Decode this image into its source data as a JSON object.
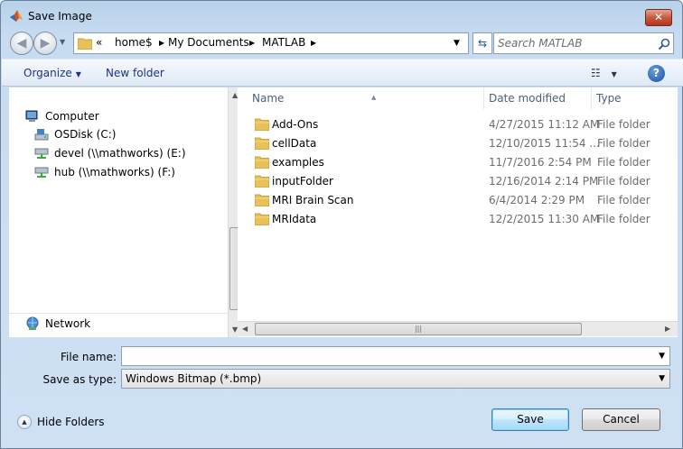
{
  "window": {
    "title": "Save Image",
    "close_glyph": "✕",
    "app_icon": "matlab-logo-icon"
  },
  "navbar": {
    "back_glyph": "◀",
    "forward_glyph": "▶",
    "overflow_glyph": "«",
    "breadcrumbs": [
      {
        "label": "home$"
      },
      {
        "label": "My Documents"
      },
      {
        "label": "MATLAB"
      }
    ],
    "search_placeholder": "Search MATLAB",
    "refresh_glyph": "⇆"
  },
  "toolbar": {
    "organize_label": "Organize",
    "new_folder_label": "New folder",
    "help_label": "?"
  },
  "nav_pane": {
    "items": [
      {
        "label": "Computer",
        "icon": "computer-icon"
      },
      {
        "label": "OSDisk (C:)",
        "icon": "drive-icon"
      },
      {
        "label": "devel (\\\\mathworks) (E:)",
        "icon": "network-drive-icon"
      },
      {
        "label": "hub (\\\\mathworks) (F:)",
        "icon": "network-drive-icon"
      }
    ],
    "network_label": "Network"
  },
  "file_list": {
    "columns": {
      "name": "Name",
      "date": "Date modified",
      "type": "Type"
    },
    "rows": [
      {
        "name": "Add-Ons",
        "date": "4/27/2015 11:12 AM",
        "type": "File folder"
      },
      {
        "name": "cellData",
        "date": "12/10/2015 11:54 ...",
        "type": "File folder"
      },
      {
        "name": "examples",
        "date": "11/7/2016 2:54 PM",
        "type": "File folder"
      },
      {
        "name": "inputFolder",
        "date": "12/16/2014 2:14 PM",
        "type": "File folder"
      },
      {
        "name": "MRI Brain Scan",
        "date": "6/4/2014 2:29 PM",
        "type": "File folder"
      },
      {
        "name": "MRIdata",
        "date": "12/2/2015 11:30 AM",
        "type": "File folder"
      }
    ]
  },
  "form": {
    "file_name_label": "File name:",
    "file_name_value": "",
    "save_type_label": "Save as type:",
    "save_type_value": "Windows Bitmap (*.bmp)"
  },
  "footer": {
    "hide_folders_label": "Hide Folders",
    "save_label": "Save",
    "cancel_label": "Cancel"
  },
  "colors": {
    "link_text": "#1e3287",
    "folder": "#e8c15a",
    "default_button_border": "#3c7fb1"
  }
}
